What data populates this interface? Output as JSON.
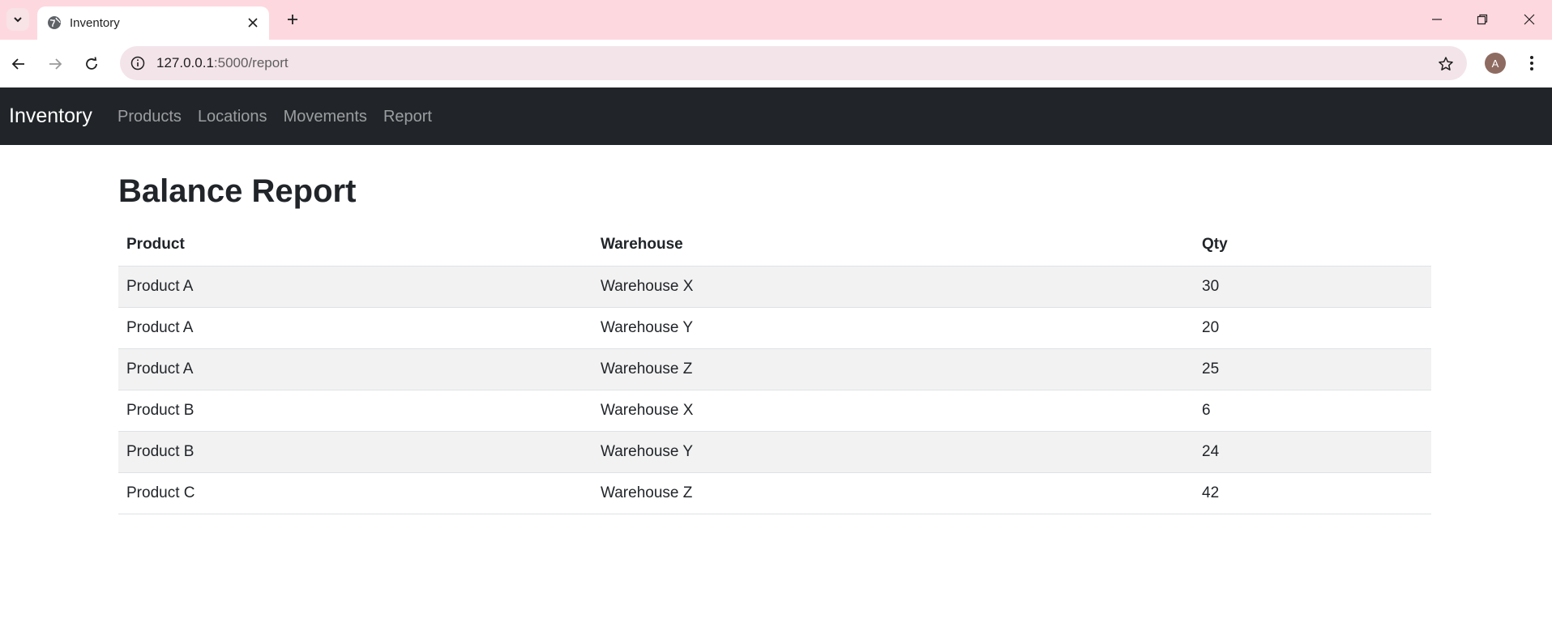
{
  "browser": {
    "tab_title": "Inventory",
    "url_host": "127.0.0.1",
    "url_path": ":5000/report",
    "profile_initial": "A"
  },
  "navbar": {
    "brand": "Inventory",
    "links": [
      "Products",
      "Locations",
      "Movements",
      "Report"
    ]
  },
  "page": {
    "title": "Balance Report",
    "table": {
      "headers": [
        "Product",
        "Warehouse",
        "Qty"
      ],
      "rows": [
        [
          "Product A",
          "Warehouse X",
          "30"
        ],
        [
          "Product A",
          "Warehouse Y",
          "20"
        ],
        [
          "Product A",
          "Warehouse Z",
          "25"
        ],
        [
          "Product B",
          "Warehouse X",
          "6"
        ],
        [
          "Product B",
          "Warehouse Y",
          "24"
        ],
        [
          "Product C",
          "Warehouse Z",
          "42"
        ]
      ]
    }
  },
  "colors": {
    "tabstrip_bg": "#fed8df",
    "navbar_bg": "#212529",
    "stripe_bg": "#f2f2f2"
  }
}
